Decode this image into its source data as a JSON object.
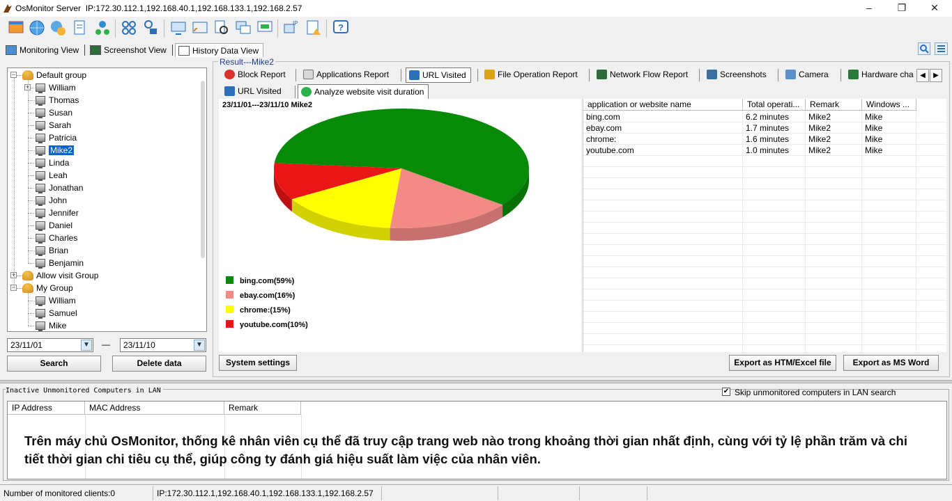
{
  "window": {
    "title": "OsMonitor Server",
    "ip_list": "IP:172.30.112.1,192.168.40.1,192.168.133.1,192.168.2.57",
    "minimize": "–",
    "maximize": "❐",
    "close": "✕"
  },
  "toolbar": {
    "icons": [
      "window-icon",
      "globe-icon",
      "settings-globe-icon",
      "report-edit-icon",
      "network-settings-icon",
      "grid-apps-icon",
      "user-lock-icon",
      "monitor-share-icon",
      "cast-icon",
      "search-doc-icon",
      "multi-window-icon",
      "presentation-icon",
      "ip-monitor-icon",
      "document-warning-icon",
      "help-icon"
    ]
  },
  "view_tabs": [
    {
      "label": "Monitoring View"
    },
    {
      "label": "Screenshot View"
    },
    {
      "label": "History Data View"
    }
  ],
  "tree": {
    "groups": [
      {
        "name": "Default group",
        "members": [
          "William",
          "Thomas",
          "Susan",
          "Sarah",
          "Patricia",
          "Mike2",
          "Linda",
          "Leah",
          "Jonathan",
          "John",
          "Jennifer",
          "Daniel",
          "Charles",
          "Brian",
          "Benjamin"
        ]
      },
      {
        "name": "Allow visit Group",
        "members": []
      },
      {
        "name": "My Group",
        "members": [
          "William",
          "Samuel",
          "Mike"
        ]
      }
    ],
    "selected": "Mike2"
  },
  "date_range": {
    "from": "23/11/01",
    "dash": "—",
    "to": "23/11/10"
  },
  "left_buttons": {
    "search": "Search",
    "delete": "Delete data"
  },
  "result": {
    "label": "Result---Mike2",
    "tabs": [
      {
        "label": "Block Report",
        "color": "#d9322b"
      },
      {
        "label": "Applications Report",
        "color": "#7a7a7a"
      },
      {
        "label": "URL Visited",
        "color": "#2a6fb8"
      },
      {
        "label": "File Operation Report",
        "color": "#d9a21a"
      },
      {
        "label": "Network Flow Report",
        "color": "#2f6b3a"
      },
      {
        "label": "Screenshots",
        "color": "#3b6fa0"
      },
      {
        "label": "Camera",
        "color": "#5a8fc9"
      },
      {
        "label": "Hardware cha",
        "color": "#2a7a3a"
      }
    ],
    "subtabs": [
      {
        "label": "URL Visited"
      },
      {
        "label": "Analyze website visit duration"
      }
    ],
    "chart_caption": "23/11/01---23/11/10  Mike2",
    "system_settings": "System settings",
    "export_excel": "Export as HTM/Excel file",
    "export_word": "Export as MS Word"
  },
  "chart_data": {
    "type": "pie",
    "title": "",
    "slices": [
      {
        "label": "bing.com(59%)",
        "value": 59,
        "color": "#078a07"
      },
      {
        "label": "ebay.com(16%)",
        "value": 16,
        "color": "#f38a86"
      },
      {
        "label": "chrome:(15%)",
        "value": 15,
        "color": "#ffff00"
      },
      {
        "label": "youtube.com(10%)",
        "value": 10,
        "color": "#e81616"
      }
    ],
    "legend_position": "bottom-left"
  },
  "grid": {
    "columns": [
      "application or website name",
      "Total operati...",
      "Remark",
      "Windows ..."
    ],
    "rows": [
      [
        "bing.com",
        "6.2 minutes",
        "Mike2",
        "Mike"
      ],
      [
        "ebay.com",
        "1.7 minutes",
        "Mike2",
        "Mike"
      ],
      [
        "chrome:",
        "1.6 minutes",
        "Mike2",
        "Mike"
      ],
      [
        "youtube.com",
        "1.0 minutes",
        "Mike2",
        "Mike"
      ]
    ]
  },
  "lan": {
    "title": "Inactive Unmonitored Computers in LAN",
    "skip_label": "Skip unmonitored computers in LAN search",
    "skip_checked": true,
    "columns": [
      "IP Address",
      "MAC Address",
      "Remark"
    ],
    "caption": "Trên máy chủ OsMonitor, thống kê nhân viên cụ thể đã truy cập trang web nào trong khoảng thời gian nhất định, cùng với tỷ lệ phần trăm và chi tiết thời gian chi tiêu cụ thể, giúp công ty đánh giá hiệu suất làm việc của nhân viên."
  },
  "status": {
    "clients": "Number of monitored clients:0",
    "ip": "IP:172.30.112.1,192.168.40.1,192.168.133.1,192.168.2.57"
  }
}
